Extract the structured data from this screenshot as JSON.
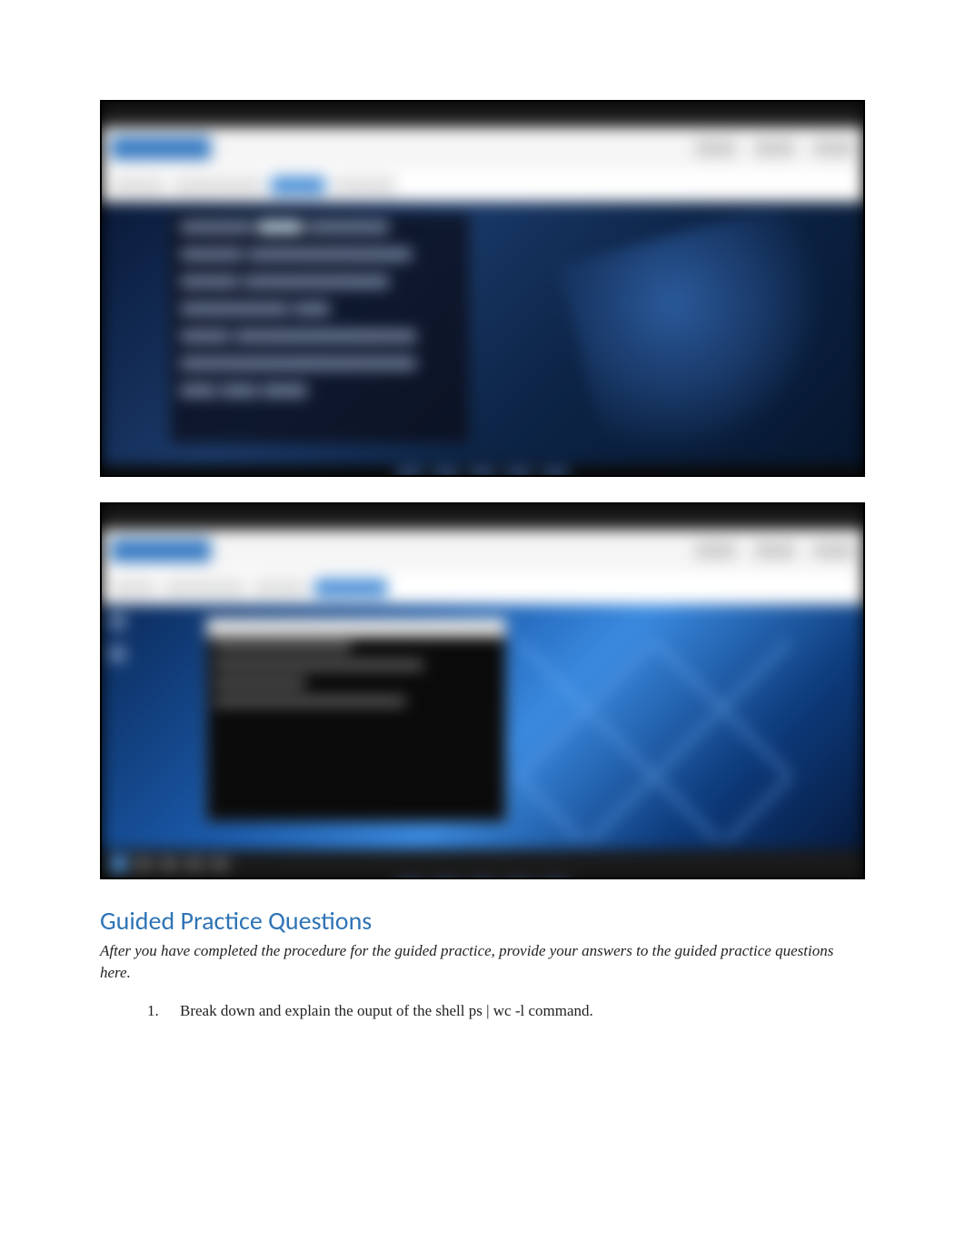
{
  "screenshots": {
    "first": {
      "description": "Blurred screenshot of a Linux desktop environment (CentOS/RHEL style) within a browser-based lab interface, showing a terminal window with command output",
      "type": "linux-desktop-lab"
    },
    "second": {
      "description": "Blurred screenshot of a Windows 10 desktop within a browser-based lab interface, showing a command prompt window",
      "type": "windows-desktop-lab"
    }
  },
  "section": {
    "heading": "Guided Practice Questions",
    "instructions": "After you have completed the procedure for the guided practice, provide your answers to the guided practice questions here."
  },
  "questions": [
    {
      "number": "1.",
      "text": "Break down and explain the ouput of the shell ps | wc -l command."
    }
  ]
}
